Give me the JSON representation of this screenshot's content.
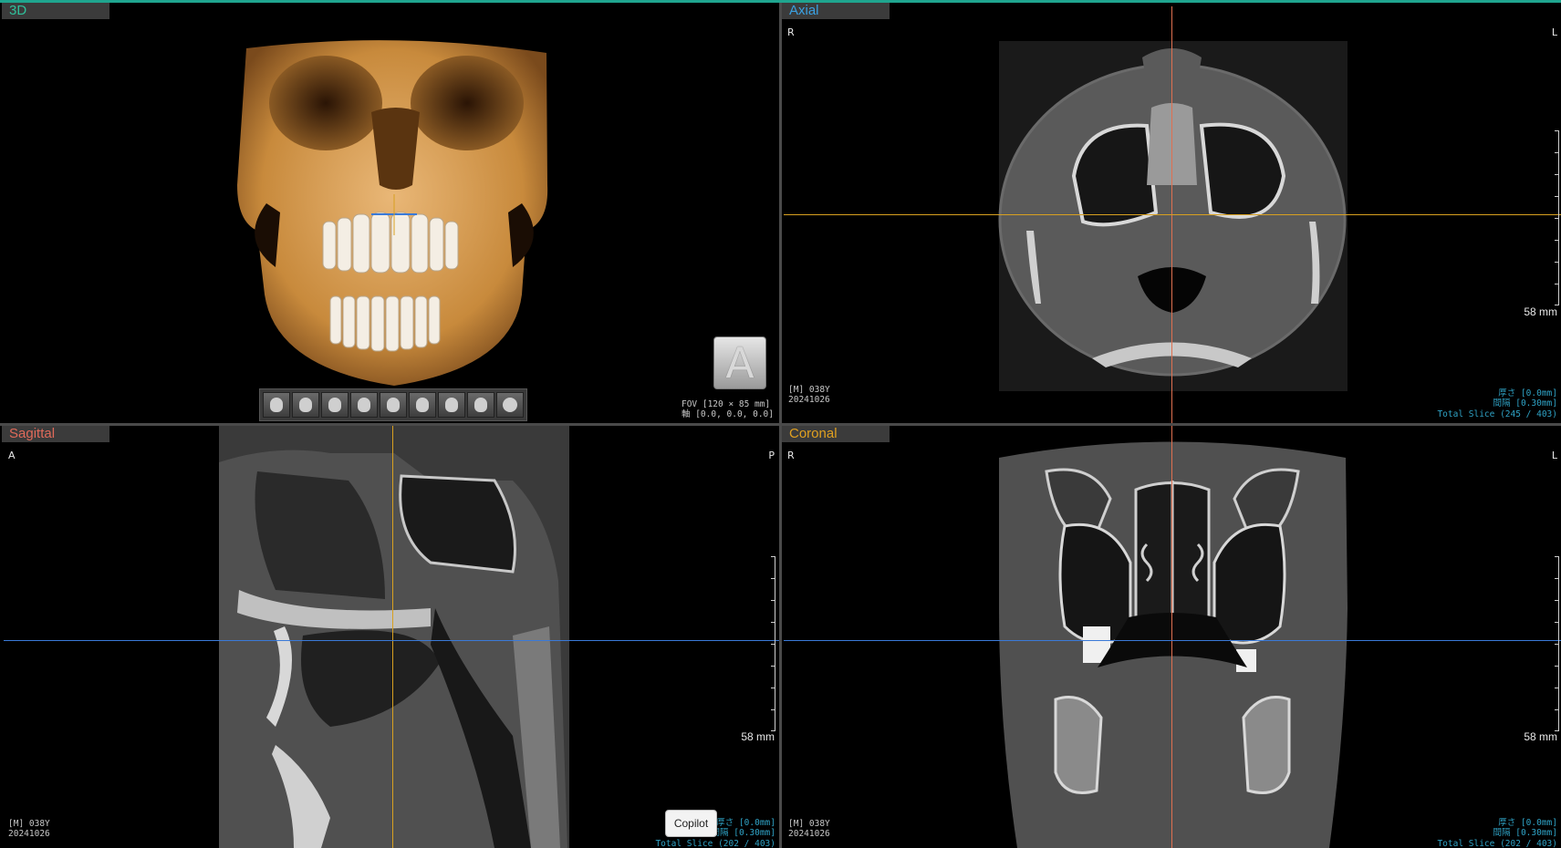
{
  "panes": {
    "three_d": {
      "title": "3D",
      "title_color": "#2fbf9a",
      "cube_label": "A",
      "fov_line1": "FOV [120 × 85 mm]",
      "fov_line2": "軸 [0.0, 0.0, 0.0]",
      "toolbar_icons": [
        "view-front-icon",
        "view-right-icon",
        "view-left-icon",
        "view-oblique-right-icon",
        "view-oblique-left-icon",
        "view-back-icon",
        "view-top-icon",
        "view-bottom-icon",
        "rotate-icon"
      ]
    },
    "axial": {
      "title": "Axial",
      "title_color": "#3aa0e0",
      "orient_left": "R",
      "orient_right": "L",
      "scale": "58 mm",
      "info_left_1": "[M] 038Y",
      "info_left_2": "20241026",
      "thickness": "厚さ [0.0mm]",
      "interval": "間隔 [0.30mm]",
      "total_slice": "Total Slice (245 / 403)"
    },
    "sagittal": {
      "title": "Sagittal",
      "title_color": "#e06a5a",
      "orient_left": "A",
      "orient_right": "P",
      "scale": "58 mm",
      "info_left_1": "[M] 038Y",
      "info_left_2": "20241026",
      "thickness": "厚さ [0.0mm]",
      "interval": "間隔 [0.30mm]",
      "total_slice": "Total Slice (202 / 403)"
    },
    "coronal": {
      "title": "Coronal",
      "title_color": "#e0a020",
      "orient_left": "R",
      "orient_right": "L",
      "scale": "58 mm",
      "info_left_1": "[M] 038Y",
      "info_left_2": "20241026",
      "thickness": "厚さ [0.0mm]",
      "interval": "間隔 [0.30mm]",
      "total_slice": "Total Slice (202 / 403)"
    }
  },
  "crosshair_colors": {
    "vertical_axial": "#e07050",
    "horizontal_axial": "#d8a020",
    "vertical_sagittal": "#d8a020",
    "horizontal": "#3a7ad8"
  },
  "copilot_label": "Copilot"
}
